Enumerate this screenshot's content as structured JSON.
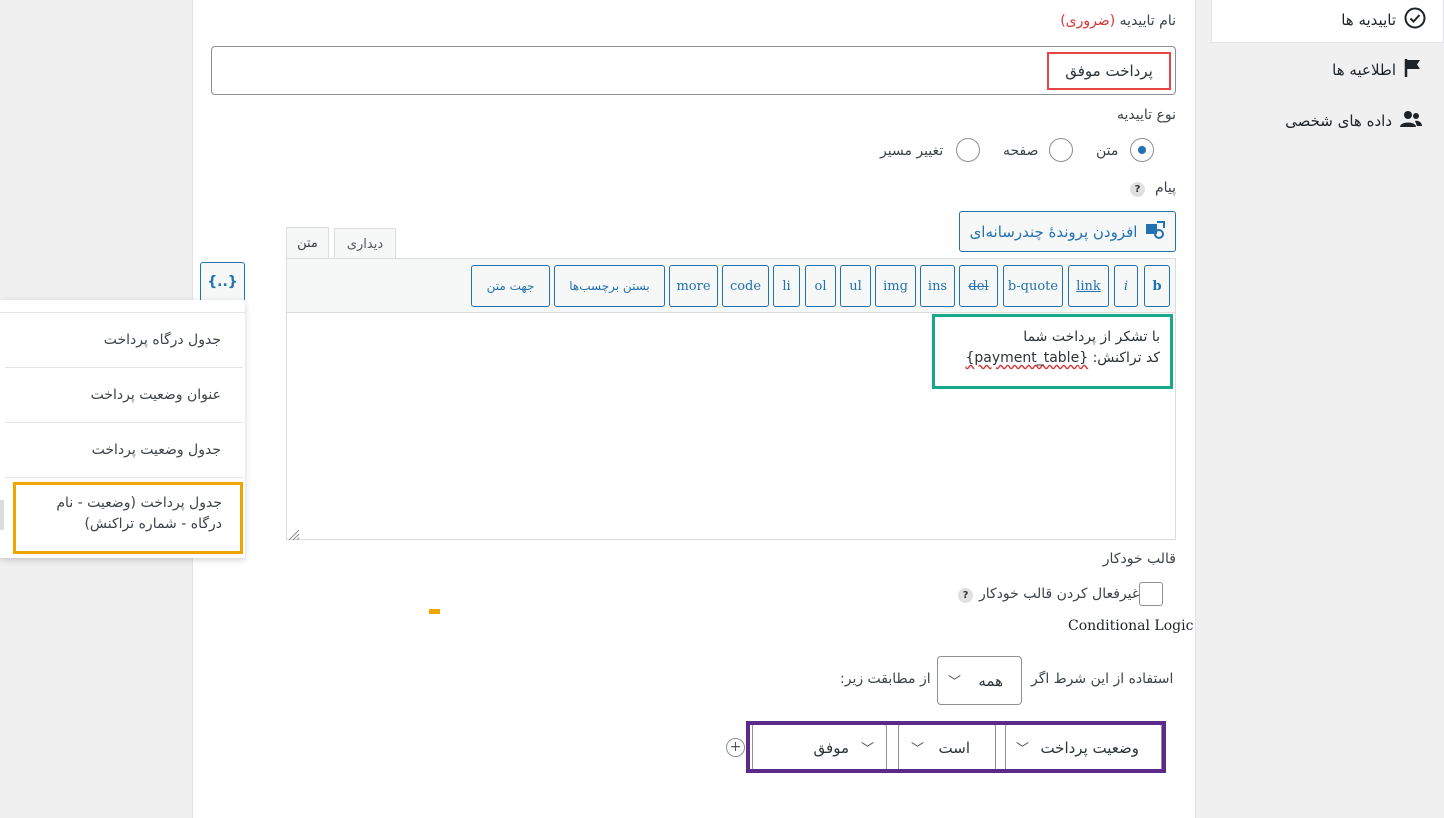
{
  "sidebar": {
    "items": [
      {
        "label": "تاییدیه ها",
        "icon": "check-circle-icon"
      },
      {
        "label": "اطلاعیه ها",
        "icon": "flag-icon"
      },
      {
        "label": "داده های شخصی",
        "icon": "users-icon"
      }
    ]
  },
  "form": {
    "confirmation_name_label": "نام تاییدیه",
    "required_text": "(ضروری)",
    "confirmation_name_value": "پرداخت موفق",
    "confirmation_type_label": "نوع تاییدیه",
    "type_options": [
      {
        "label": "متن",
        "checked": true
      },
      {
        "label": "صفحه",
        "checked": false
      },
      {
        "label": "تغییر مسیر",
        "checked": false
      }
    ],
    "message_label": "پیام",
    "help_symbol": "?",
    "add_media_label": "افزودن پروندهٔ چندرسانه‌ای"
  },
  "editor": {
    "tab_text": "متن",
    "tab_visual": "دیداری",
    "quicktags": [
      "b",
      "i",
      "link",
      "b-quote",
      "del",
      "ins",
      "img",
      "ul",
      "ol",
      "li",
      "code",
      "more",
      "بستن برچسب‌ها",
      "جهت متن"
    ],
    "content_line1": "با تشکر از پرداخت شما",
    "content_line2_prefix": "کد تراکنش:",
    "content_token": "{payment_table}"
  },
  "merge_tags": {
    "button_label": "{..}",
    "items": [
      "جدول درگاه پرداخت",
      "عنوان وضعیت پرداخت",
      "جدول وضعیت پرداخت",
      "جدول پرداخت (وضعیت - نام درگاه - شماره تراکنش)"
    ]
  },
  "autoformat": {
    "label": "قالب خودکار",
    "checkbox_label": "غیرفعال کردن قالب خودکار"
  },
  "conditional": {
    "title": "Conditional Logic",
    "use_if_label": "استفاده از این شرط اگر",
    "match_select": "همه",
    "match_suffix": "از مطابقت زیر:",
    "rule": {
      "field": "وضعیت پرداخت",
      "operator": "است",
      "value": "موفق"
    }
  },
  "colors": {
    "accent": "#2271b1",
    "highlight_red": "#e84545",
    "highlight_green": "#17a98a",
    "highlight_yellow": "#f0a500",
    "highlight_purple": "#5e2a8a"
  }
}
